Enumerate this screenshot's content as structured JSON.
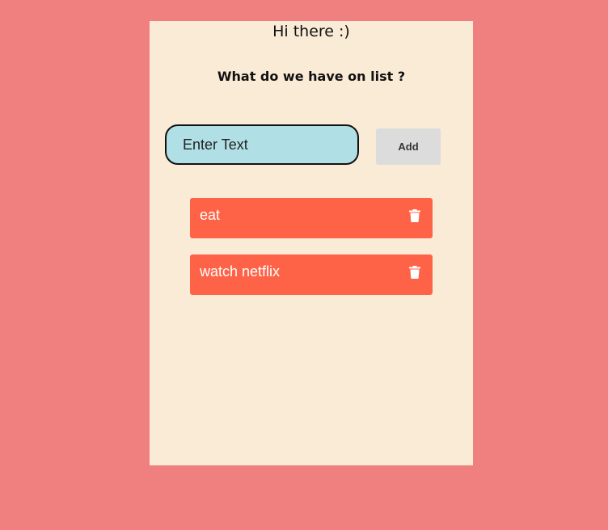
{
  "header": {
    "greeting": "Hi there :)",
    "subtitle": "What do we have on list ?"
  },
  "form": {
    "input_placeholder": "Enter Text",
    "input_value": "",
    "add_label": "Add"
  },
  "todos": [
    {
      "text": "eat",
      "icon": "trash-icon"
    },
    {
      "text": "watch netflix",
      "icon": "trash-icon"
    }
  ],
  "colors": {
    "page_background": "#f08080",
    "card_background": "#faebd7",
    "input_background": "#b0e0e6",
    "item_background": "#ff6347",
    "button_background": "#dcdcdc"
  }
}
